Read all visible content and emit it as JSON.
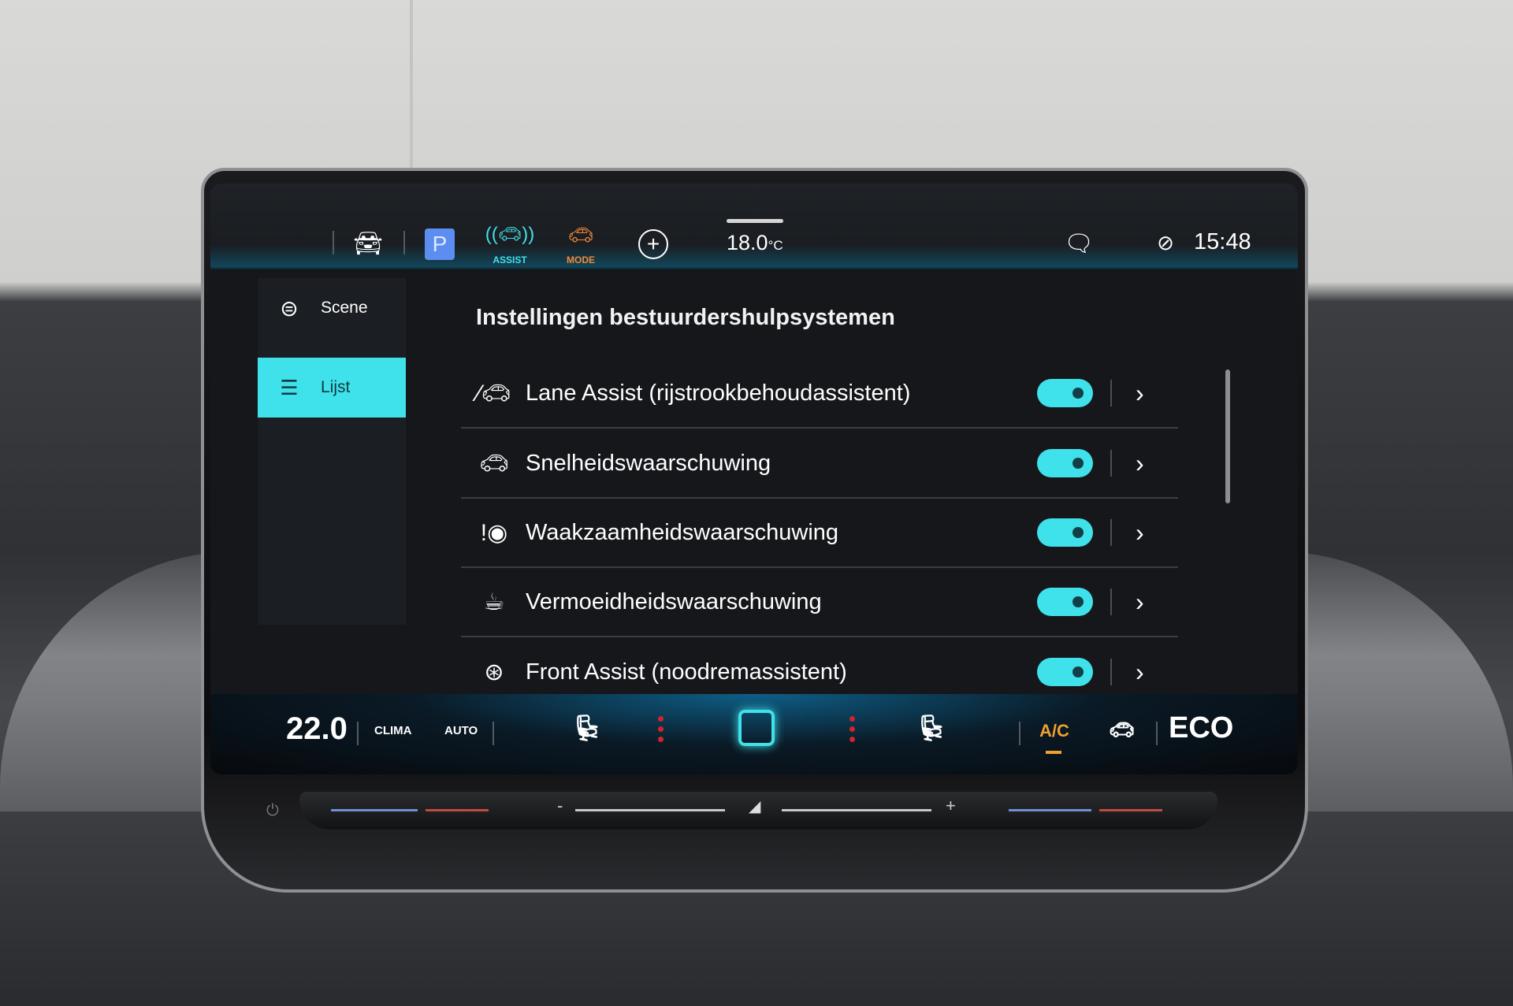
{
  "topbar": {
    "parking_label": "P",
    "assist_label": "ASSIST",
    "mode_label": "MODE",
    "temperature": "18.0",
    "temperature_unit": "°C",
    "clock": "15:48"
  },
  "sidebar": {
    "items": [
      {
        "label": "Scene",
        "icon": "steering-car-icon",
        "active": false
      },
      {
        "label": "Lijst",
        "icon": "list-icon",
        "active": true
      }
    ]
  },
  "main": {
    "title": "Instellingen bestuurdershulpsystemen",
    "rows": [
      {
        "label": "Lane Assist (rijstrookbehoudassistent)",
        "icon": "lane-assist-icon",
        "enabled": true
      },
      {
        "label": "Snelheidswaarschuwing",
        "icon": "speed-warning-icon",
        "enabled": true
      },
      {
        "label": "Waakzaamheidswaarschuwing",
        "icon": "attention-eye-icon",
        "enabled": true
      },
      {
        "label": "Vermoeidheidswaarschuwing",
        "icon": "coffee-cup-icon",
        "enabled": true
      },
      {
        "label": "Front Assist (noodremassistent)",
        "icon": "front-assist-icon",
        "enabled": true
      }
    ]
  },
  "climate": {
    "temperature": "22.0",
    "clima_label": "CLIMA",
    "auto_label": "AUTO",
    "ac_label": "A/C",
    "eco_label": "ECO",
    "slider_minus": "-",
    "slider_plus": "+"
  },
  "colors": {
    "accent": "#3fe1ea",
    "mode": "#f08a3c",
    "parking": "#5b8ef0",
    "ac": "#f0a030",
    "seat_heat": "#d0242c"
  }
}
